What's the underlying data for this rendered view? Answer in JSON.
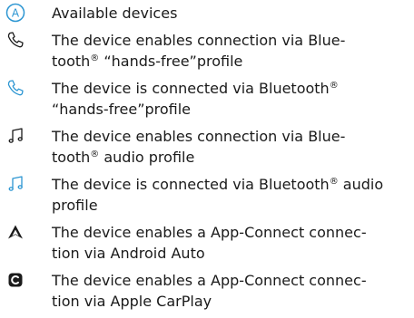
{
  "colors": {
    "active": "#2d96d2",
    "inactive": "#1a1a1a"
  },
  "legend": [
    {
      "icon": "letter-a-circle-icon",
      "lines": [
        "Available devices"
      ]
    },
    {
      "icon": "phone-handset-icon",
      "lines": [
        "The device enables connection via Blue-",
        "tooth® “hands-free”profile"
      ]
    },
    {
      "icon": "phone-handset-connected-icon",
      "lines": [
        "The device is connected via Bluetooth®",
        "“hands-free”profile"
      ]
    },
    {
      "icon": "music-note-icon",
      "lines": [
        "The device enables connection via Blue-",
        "tooth® audio profile"
      ]
    },
    {
      "icon": "music-note-connected-icon",
      "lines": [
        "The device is connected via Bluetooth® audio",
        "profile"
      ]
    },
    {
      "icon": "android-auto-icon",
      "lines": [
        "The device enables a App-Connect connec-",
        "tion via Android Auto"
      ]
    },
    {
      "icon": "apple-carplay-icon",
      "lines": [
        "The device enables a App-Connect connec-",
        "tion via Apple CarPlay"
      ]
    }
  ]
}
